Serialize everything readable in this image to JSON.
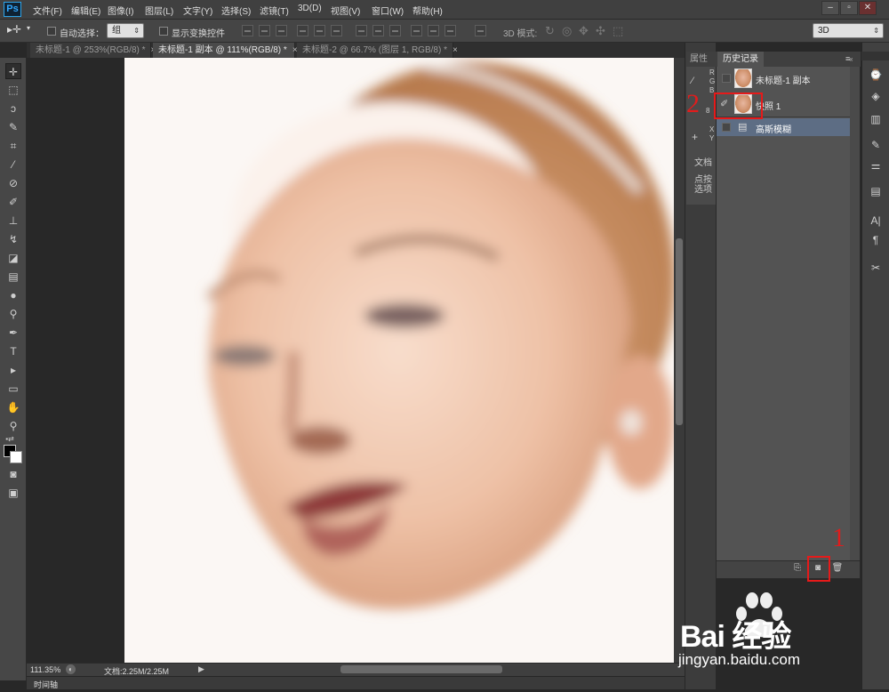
{
  "app": {
    "logo": "Ps"
  },
  "menu": [
    "文件(F)",
    "编辑(E)",
    "图像(I)",
    "图层(L)",
    "文字(Y)",
    "选择(S)",
    "滤镜(T)",
    "3D(D)",
    "视图(V)",
    "窗口(W)",
    "帮助(H)"
  ],
  "window_controls": [
    "minimize-icon",
    "restore-icon",
    "close-icon"
  ],
  "options": {
    "auto_select_label": "自动选择：",
    "group_value": "组",
    "show_transform_label": "显示变换控件",
    "mode_label": "3D 模式:",
    "workspace": "3D"
  },
  "tabs": [
    {
      "label": "未标题-1 @ 253%(RGB/8) *",
      "active": false
    },
    {
      "label": "未标题-1 副本 @ 111%(RGB/8) *",
      "active": true
    },
    {
      "label": "未标题-2 @ 66.7% (图层 1, RGB/8) *",
      "active": false
    }
  ],
  "status": {
    "zoom": "111.35%",
    "doc": "文档:2.25M/2.25M"
  },
  "timeline_label": "时间轴",
  "props_panel": {
    "tab": "属性",
    "lines": [
      "R",
      "G",
      "B",
      "8",
      "X",
      "Y"
    ],
    "doc_label": "文档",
    "hint_line1": "点按",
    "hint_line2": "选项"
  },
  "history_panel": {
    "tab": "历史记录",
    "items": [
      {
        "label": "未标题-1 副本",
        "type": "snapshot",
        "selected": false
      },
      {
        "label": "快照 1",
        "type": "snapshot",
        "selected": false
      },
      {
        "label": "高斯模糊",
        "type": "step",
        "selected": true
      }
    ]
  },
  "annotations": {
    "one": "1",
    "two": "2"
  },
  "watermark": {
    "brand": "Bai 经验",
    "url": "jingyan.baidu.com"
  },
  "colors": {
    "accent_red": "#e61a1a",
    "selected_row": "#5d6d84",
    "ps_blue": "#31a8ff"
  }
}
